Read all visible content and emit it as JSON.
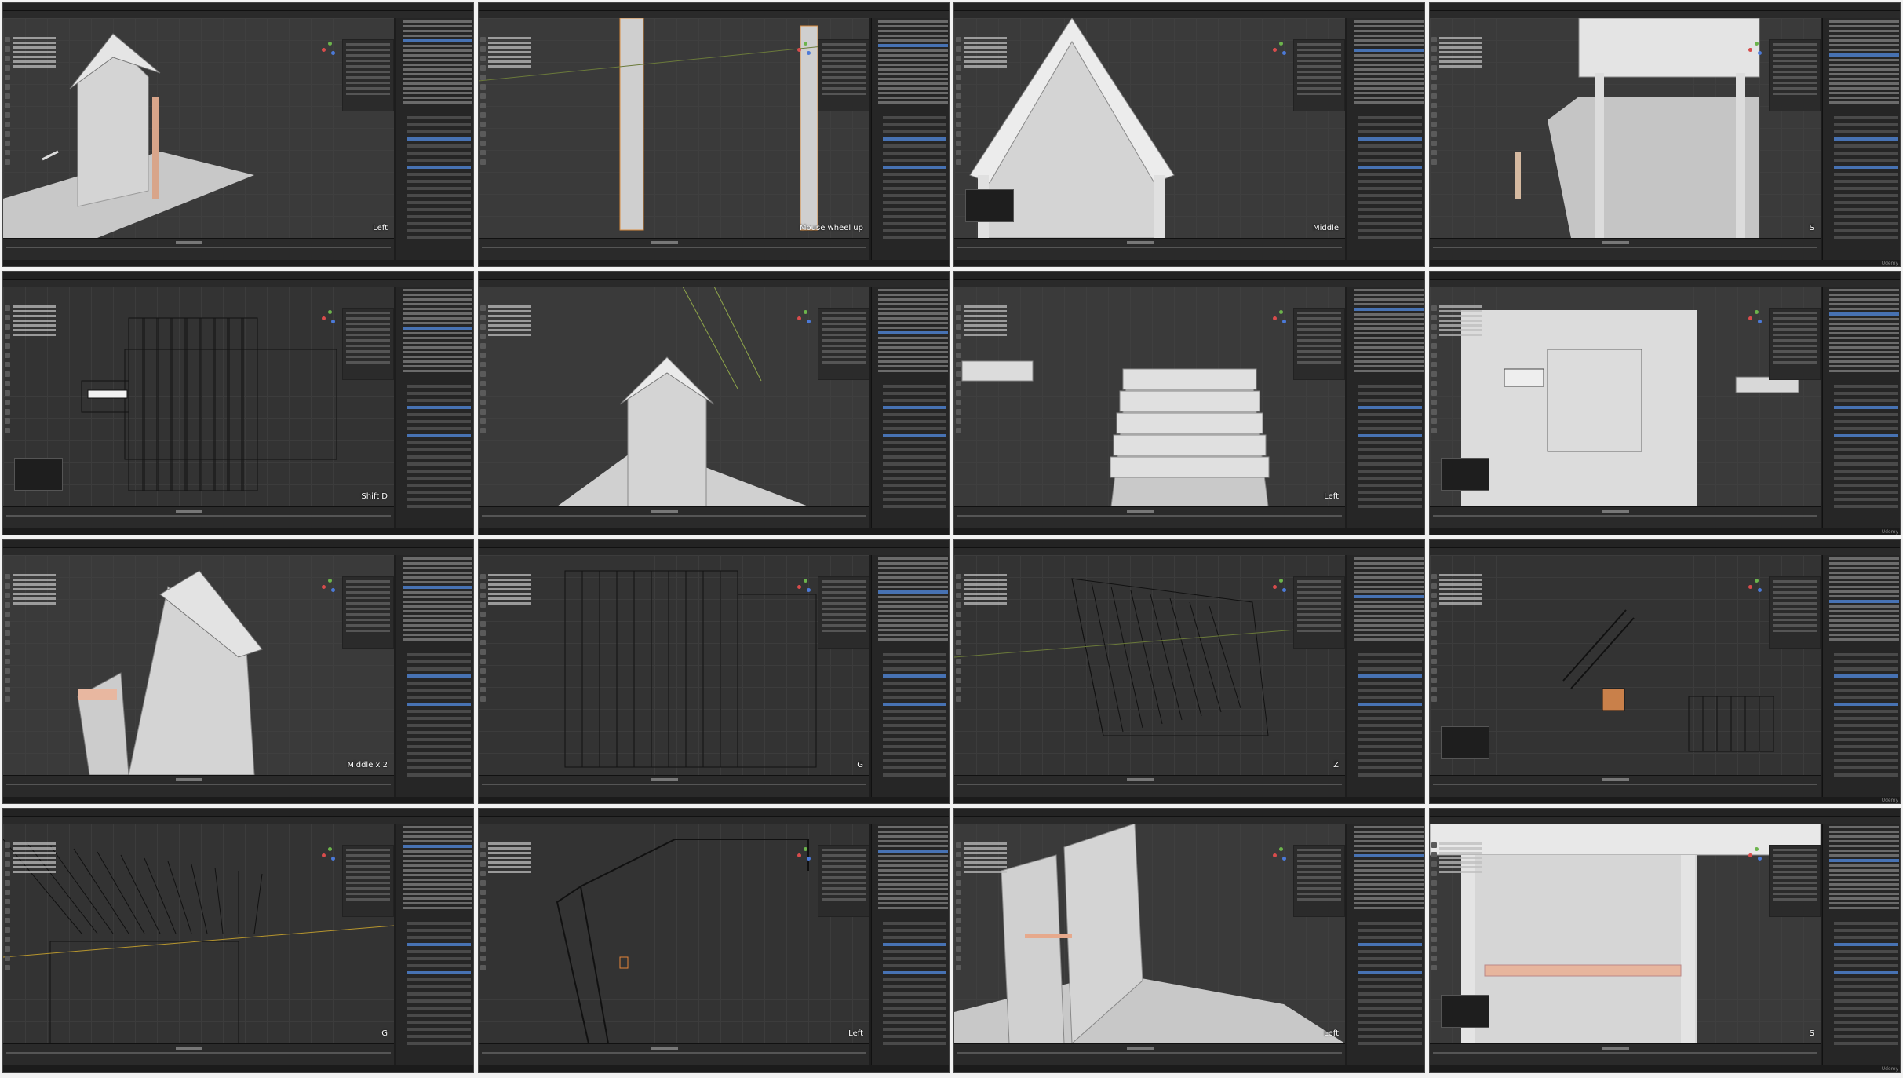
{
  "tiles": [
    {
      "key_overlay": "Left",
      "scene": "house-3q",
      "shade": "solid"
    },
    {
      "key_overlay": "Mouse wheel up",
      "scene": "posts",
      "shade": "solid"
    },
    {
      "key_overlay": "Middle",
      "scene": "house-front",
      "shade": "solid"
    },
    {
      "key_overlay": "S",
      "scene": "house-top",
      "shade": "solid"
    },
    {
      "key_overlay": "Shift D",
      "scene": "wire-top",
      "shade": "wire"
    },
    {
      "key_overlay": "",
      "scene": "house-small",
      "shade": "solid"
    },
    {
      "key_overlay": "Left",
      "scene": "roof-tiles",
      "shade": "solid"
    },
    {
      "key_overlay": "",
      "scene": "plane-top",
      "shade": "solid"
    },
    {
      "key_overlay": "Middle x 2",
      "scene": "house-side",
      "shade": "solid"
    },
    {
      "key_overlay": "G",
      "scene": "wire-flat",
      "shade": "wire"
    },
    {
      "key_overlay": "Z",
      "scene": "wire-persp",
      "shade": "wire"
    },
    {
      "key_overlay": "",
      "scene": "wire-small",
      "shade": "wire"
    },
    {
      "key_overlay": "G",
      "scene": "wire-roof",
      "shade": "wire"
    },
    {
      "key_overlay": "Left",
      "scene": "wire-frame",
      "shade": "wire"
    },
    {
      "key_overlay": "Left",
      "scene": "house-bench",
      "shade": "solid"
    },
    {
      "key_overlay": "S",
      "scene": "house-inside",
      "shade": "solid"
    }
  ],
  "watermark": "Udemy",
  "colors": {
    "viewport": "#3a3a3a",
    "panel": "#262626",
    "selection": "#4772b3",
    "highlight": "#e6853a",
    "mesh": "#d9d9d9"
  }
}
